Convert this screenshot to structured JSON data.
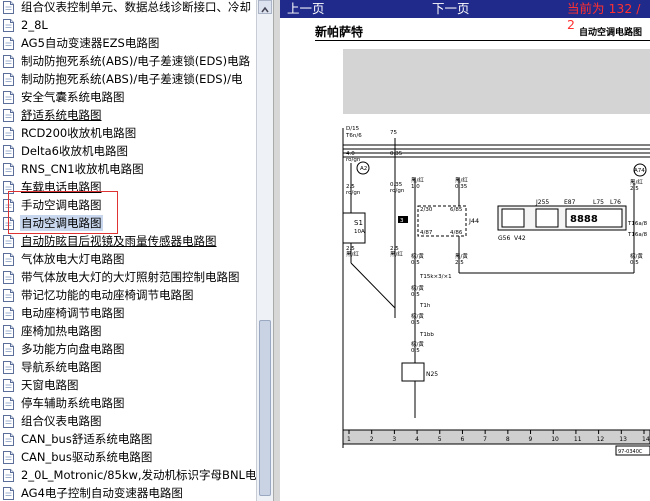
{
  "tree": {
    "items": [
      {
        "label": "组合仪表控制单元、数据总线诊断接口、冷却"
      },
      {
        "label": "2_8L"
      },
      {
        "label": "AG5自动变速器EZS电路图"
      },
      {
        "label": "制动防抱死系统(ABS)/电子差速锁(EDS)电路"
      },
      {
        "label": "制动防抱死系统(ABS)/电子差速锁(EDS)/电"
      },
      {
        "label": "安全气囊系统电路图"
      },
      {
        "label": "舒适系统电路图"
      },
      {
        "label": "RCD200收放机电路图"
      },
      {
        "label": "Delta6收放机电路图"
      },
      {
        "label": "RNS_CN1收放机电路图"
      },
      {
        "label": "车载电话电路图"
      },
      {
        "label": "手动空调电路图"
      },
      {
        "label": "自动空调电路图"
      },
      {
        "label": "自动防眩目后视镜及雨量传感器电路图"
      },
      {
        "label": "气体放电大灯电路图"
      },
      {
        "label": "带气体放电大灯的大灯照射范围控制电路图"
      },
      {
        "label": "带记忆功能的电动座椅调节电路图"
      },
      {
        "label": "电动座椅调节电路图"
      },
      {
        "label": "座椅加热电路图"
      },
      {
        "label": "多功能方向盘电路图"
      },
      {
        "label": "导航系统电路图"
      },
      {
        "label": "天窗电路图"
      },
      {
        "label": "停车辅助系统电路图"
      },
      {
        "label": "组合仪表电路图"
      },
      {
        "label": "CAN_bus舒适系统电路图"
      },
      {
        "label": "CAN_bus驱动系统电路图"
      },
      {
        "label": "2_0L_Motronic/85kw,发动机标识字母BNL电"
      },
      {
        "label": "AG4电子控制自动变速器电路图"
      }
    ],
    "selected_index": 12
  },
  "viewer": {
    "prev_label": "上一页",
    "next_label": "下一页",
    "current_label": "当前为  132 / 2",
    "doc_title": "新帕萨特",
    "doc_subtitle": "自动空调电路图",
    "diagram": {
      "labels": {
        "d15": "D/15",
        "d15b": "T6n/6",
        "d15c": "4.0",
        "d15d": "ro/gn",
        "k75": "75",
        "k75b": "0.35",
        "a2": "A2",
        "w1a": "2.5",
        "w1b": "ro/gn",
        "w2a": "0.35",
        "w2b": "ro/gn",
        "w3a": "黑/红",
        "w3b": "1.0",
        "w4a": "黑/红",
        "w4b": "0.35",
        "a74": "A74",
        "w5a": "黑/红",
        "w5b": "2.5",
        "s1": "S1",
        "s1b": "10A",
        "w6a": "2.5",
        "w6b": "黑/红",
        "num3": "3",
        "t20": "2/30",
        "t6n": "6/85",
        "j44": "J44",
        "t87": "4/87",
        "t86": "4/86",
        "j255": "J255",
        "e87": "E87",
        "e87disp": "8888",
        "l75": "L75",
        "l76": "L76",
        "t16a": "T16a/8",
        "t16b": "T16a/8",
        "g56": "G56",
        "v42": "V42",
        "w7a": "2.5",
        "w7b": "黑/红",
        "w8a": "棕/黄",
        "w8b": "0.5",
        "w9a": "黑/黄",
        "w9b": "2.5",
        "w10a": "棕/黄",
        "w10b": "0.5",
        "t15": "T15k×3/×1",
        "w11a": "棕/黄",
        "w11b": "0.5",
        "t1h": "T1h",
        "w12a": "棕/黄",
        "w12b": "0.5",
        "t1bb": "T1bb",
        "w13a": "棕/黄",
        "w13b": "0.5",
        "n25": "N25",
        "ref": "97-0340C",
        "ruler": [
          "1",
          "2",
          "3",
          "4",
          "5",
          "6",
          "7",
          "8",
          "9",
          "10",
          "11",
          "12",
          "13",
          "14"
        ]
      }
    }
  }
}
